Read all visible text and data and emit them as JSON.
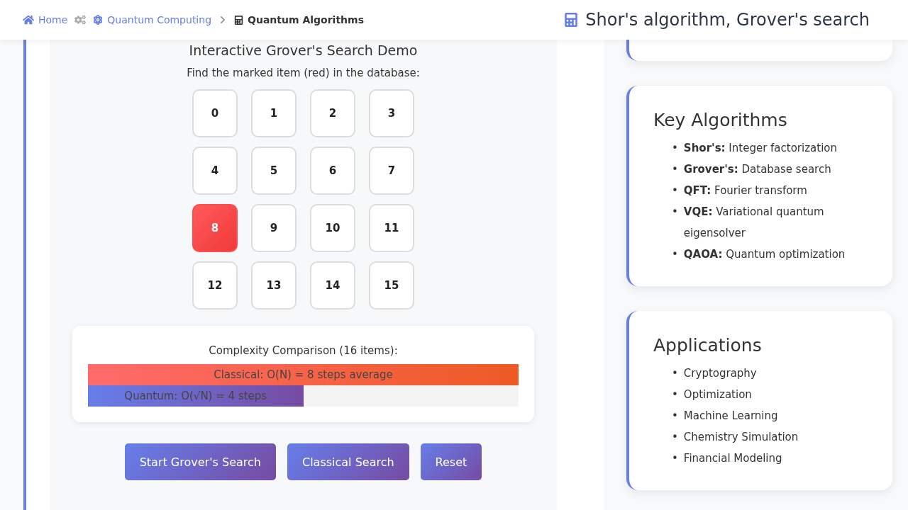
{
  "breadcrumb": [
    {
      "label": "Home",
      "kind": "home",
      "current": false
    },
    {
      "label": "Quantum Computing",
      "kind": "atom",
      "current": false
    },
    {
      "label": "Quantum Algorithms",
      "kind": "calculator",
      "current": true
    }
  ],
  "page_title": "Shor's algorithm, Grover's search",
  "demo": {
    "title": "Interactive Grover's Search Demo",
    "instruction": "Find the marked item (red) in the database:",
    "items": [
      {
        "label": "0",
        "marked": false
      },
      {
        "label": "1",
        "marked": false
      },
      {
        "label": "2",
        "marked": false
      },
      {
        "label": "3",
        "marked": false
      },
      {
        "label": "4",
        "marked": false
      },
      {
        "label": "5",
        "marked": false
      },
      {
        "label": "6",
        "marked": false
      },
      {
        "label": "7",
        "marked": false
      },
      {
        "label": "8",
        "marked": true
      },
      {
        "label": "9",
        "marked": false
      },
      {
        "label": "10",
        "marked": false
      },
      {
        "label": "11",
        "marked": false
      },
      {
        "label": "12",
        "marked": false
      },
      {
        "label": "13",
        "marked": false
      },
      {
        "label": "14",
        "marked": false
      },
      {
        "label": "15",
        "marked": false
      }
    ],
    "comparison": {
      "title": "Complexity Comparison (16 items):",
      "bars": [
        {
          "kind": "classical",
          "label": "Classical: O(N) = 8 steps average",
          "level": 1.0
        },
        {
          "kind": "quantum",
          "label": "Quantum: O(√N) = 4 steps",
          "level": 0.5
        }
      ]
    },
    "buttons": [
      "Start Grover's Search",
      "Classical Search",
      "Reset"
    ]
  },
  "cards": [
    {
      "title": "Key Algorithms",
      "bullet": "•",
      "items": [
        "**Shor's:** Integer factorization",
        "**Grover's:** Database search",
        "**QFT:** Fourier transform",
        "**VQE:** Variational quantum eigensolver",
        "**QAOA:** Quantum optimization"
      ]
    },
    {
      "title": "Applications",
      "bullet": "•",
      "items": [
        "Cryptography",
        "Optimization",
        "Machine Learning",
        "Chemistry Simulation",
        "Financial Modeling"
      ]
    }
  ]
}
